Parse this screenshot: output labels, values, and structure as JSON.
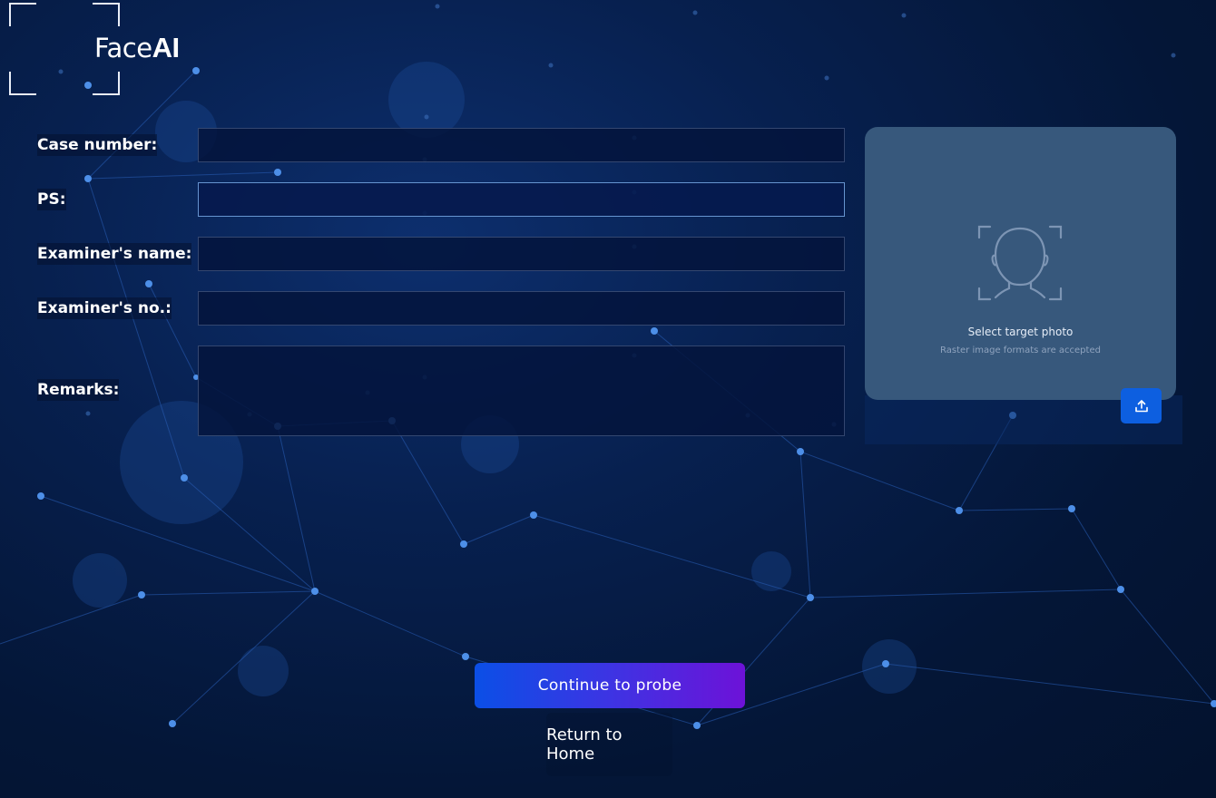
{
  "app": {
    "logo_regular": "Face",
    "logo_bold": "AI"
  },
  "form": {
    "case_number_label": "Case number:",
    "case_number_value": "",
    "ps_label": "PS:",
    "ps_value": "",
    "examiner_name_label": "Examiner's name:",
    "examiner_name_value": "",
    "examiner_no_label": "Examiner's no.:",
    "examiner_no_value": "",
    "remarks_label": "Remarks:",
    "remarks_value": ""
  },
  "upload": {
    "title": "Select target photo",
    "subtitle": "Raster image formats are accepted",
    "face_icon": "face-scan-icon",
    "upload_icon": "upload-icon"
  },
  "actions": {
    "continue_label": "Continue to probe",
    "home_label": "Return to Home"
  },
  "colors": {
    "background": "#041637",
    "panel": "#37587c",
    "upload_button": "#0d5fe0",
    "gradient_start": "#0b4fe6",
    "gradient_end": "#6d12d8"
  }
}
